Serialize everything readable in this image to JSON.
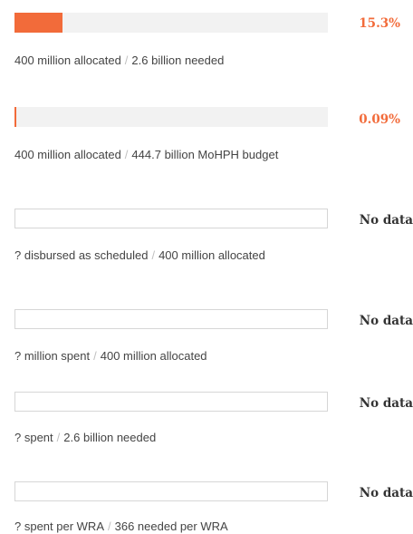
{
  "indicators": [
    {
      "value_label": "15.3%",
      "fraction": 0.153,
      "numerator": "400 million allocated",
      "separator": "/",
      "denominator": "2.6 billion needed"
    },
    {
      "value_label": "0.09%",
      "fraction": 0.0009,
      "numerator": "400 million allocated",
      "separator": "/",
      "denominator": "444.7 billion MoHPH budget"
    },
    {
      "value_label": "No data",
      "numerator": "? disbursed as scheduled",
      "separator": "/",
      "denominator": "400 million allocated"
    },
    {
      "value_label": "No data",
      "numerator": "? million spent",
      "separator": "/",
      "denominator": "400 million allocated"
    },
    {
      "value_label": "No data",
      "numerator": "? spent",
      "separator": "/",
      "denominator": "2.6 billion needed"
    },
    {
      "value_label": "No data",
      "numerator": "? spent per WRA",
      "separator": "/",
      "denominator": "366 needed per WRA"
    }
  ],
  "colors": {
    "accent": "#f26b3a",
    "track": "#f2f2f2",
    "border": "#d6d6d6"
  }
}
